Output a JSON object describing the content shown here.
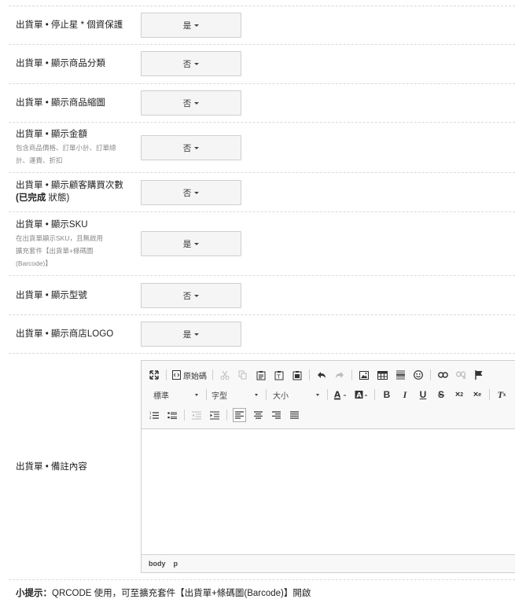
{
  "settings": [
    {
      "label": "出貨單 • 停止星 * 個資保護",
      "value": "是"
    },
    {
      "label": "出貨單 • 顯示商品分類",
      "value": "否"
    },
    {
      "label": "出貨單 • 顯示商品縮圖",
      "value": "否"
    },
    {
      "label": "出貨單 • 顯示金額",
      "sub1": "包含商品價格、訂單小計、訂單總",
      "sub2": "計、運費、折扣",
      "value": "否"
    },
    {
      "label": "出貨單 • 顯示顧客購買次數",
      "label2_bold": "(已完成",
      "label2_rest": " 狀態)",
      "value": "否"
    },
    {
      "label": "出貨單 • 顯示SKU",
      "sub1": "在出貨單顯示SKU，且無啟用",
      "sub2": "擴充套件【出貨單+條碼圖",
      "sub3": "(Barcode)】",
      "value": "是"
    },
    {
      "label": "出貨單 • 顯示型號",
      "value": "否"
    },
    {
      "label": "出貨單 • 顯示商店LOGO",
      "value": "是"
    }
  ],
  "notes": {
    "label": "出貨單 • 備註內容",
    "toolbar": {
      "source_label": "原始碼",
      "format_label": "標準",
      "font_label": "字型",
      "size_label": "大小"
    },
    "statusbar": [
      "body",
      "p"
    ]
  },
  "hint": {
    "prefix": "小提示：",
    "text": "QRCODE 使用，可至擴充套件【出貨單+條碼圖(Barcode)】開啟"
  }
}
